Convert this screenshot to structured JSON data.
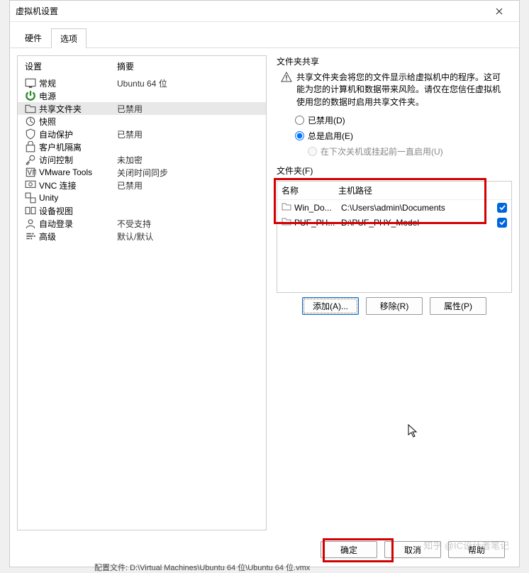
{
  "title": "虚拟机设置",
  "tabs": {
    "hardware": "硬件",
    "options": "选项"
  },
  "columns": {
    "setting": "设置",
    "summary": "摘要"
  },
  "settings": [
    {
      "key": "general",
      "label": "常规",
      "value": "Ubuntu 64 位"
    },
    {
      "key": "power",
      "label": "电源",
      "value": ""
    },
    {
      "key": "shared-folders",
      "label": "共享文件夹",
      "value": "已禁用",
      "selected": true
    },
    {
      "key": "snapshot",
      "label": "快照",
      "value": ""
    },
    {
      "key": "auto-protect",
      "label": "自动保护",
      "value": "已禁用"
    },
    {
      "key": "guest-isolation",
      "label": "客户机隔离",
      "value": ""
    },
    {
      "key": "access-control",
      "label": "访问控制",
      "value": "未加密"
    },
    {
      "key": "vmware-tools",
      "label": "VMware Tools",
      "value": "关闭时间同步"
    },
    {
      "key": "vnc",
      "label": "VNC 连接",
      "value": "已禁用"
    },
    {
      "key": "unity",
      "label": "Unity",
      "value": ""
    },
    {
      "key": "device-view",
      "label": "设备视图",
      "value": ""
    },
    {
      "key": "autologon",
      "label": "自动登录",
      "value": "不受支持"
    },
    {
      "key": "advanced",
      "label": "高级",
      "value": "默认/默认"
    }
  ],
  "share": {
    "group_title": "文件夹共享",
    "warning": "共享文件夹会将您的文件显示给虚拟机中的程序。这可能为您的计算机和数据带来风险。请仅在您信任虚拟机使用您的数据时启用共享文件夹。",
    "radio_disabled": "已禁用(D)",
    "radio_always": "总是启用(E)",
    "radio_until": "在下次关机或挂起前一直启用(U)"
  },
  "folders": {
    "group_title": "文件夹(F)",
    "col_name": "名称",
    "col_path": "主机路径",
    "rows": [
      {
        "name": "Win_Do...",
        "path": "C:\\Users\\admin\\Documents"
      },
      {
        "name": "PUF_PH...",
        "path": "D:\\PUF_PHY_Model"
      }
    ],
    "btn_add": "添加(A)...",
    "btn_remove": "移除(R)",
    "btn_props": "属性(P)"
  },
  "buttons": {
    "ok": "确定",
    "cancel": "取消",
    "help": "帮助"
  },
  "footer": "配置文件: D:\\Virtual Machines\\Ubuntu 64 位\\Ubuntu 64 位.vmx",
  "watermark": "知乎 @IC设计者笔记"
}
